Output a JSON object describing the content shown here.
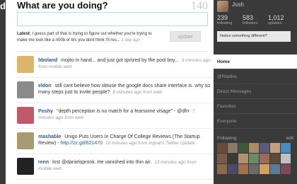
{
  "header": {
    "logo_fragment": "d",
    "question": "What are you doing?",
    "char_count": "140",
    "update_button": "update",
    "latest_label": "Latest:",
    "latest_text": "I guess part of that is trying to figure out whether you're trying to make me look like a n00b or b/c you dont think I'll res...",
    "latest_meta": "1 day ago"
  },
  "tweets": [
    {
      "user": "bboland",
      "text": "mojito in hand... and just got sprized by the pool boy...",
      "meta": "6 minutes ago from mobile web",
      "link": "",
      "avatar_color": "#d9b56e"
    },
    {
      "user": "eldon",
      "text": "still cant believe how obtuse the google docs share interface is. why so many steps just to invite people?",
      "meta": "6 minutes ago from web",
      "link": "",
      "avatar_color": "#8a8a8a"
    },
    {
      "user": "Poshy",
      "text": "\"depth perception is no match for a fearsome visage\" - @dfrr",
      "meta": "7 minutes ago from web",
      "link": "",
      "avatar_color": "#c05a6a"
    },
    {
      "user": "mashable",
      "text": "Unigo Puts Users In Charge Of College Reviews (The Startup Review) -",
      "meta": "10 minutes ago from Ingoal's Twitter Update",
      "link": "http://zz.gd/621470",
      "avatar_color": "#a89a72"
    },
    {
      "user": "renn",
      "text": "lost @danielspronk. He vanished into thin air.",
      "meta": "13 minutes ago from mobile web",
      "link": "",
      "avatar_color": "#222222"
    }
  ],
  "sidebar": {
    "name": "Josh",
    "stats": [
      {
        "num": "239",
        "label": "following"
      },
      {
        "num": "583",
        "label": "followers"
      },
      {
        "num": "1,012",
        "label": "updates"
      }
    ],
    "notice": "Notice something different?",
    "nav": [
      {
        "label": "Home",
        "active": true
      },
      {
        "label": "@Replies",
        "active": false
      },
      {
        "label": "Direct Messages",
        "active": false
      },
      {
        "label": "Favorites",
        "active": false
      },
      {
        "label": "Everyone",
        "active": false
      }
    ],
    "following_label": "Following",
    "following_action": "edit"
  },
  "colors": {
    "accent_link": "#2a5a8a",
    "sidebar_bg": "#3a3a3a",
    "box_border": "#b7d8e8"
  },
  "following_avatar_colors": [
    "#6a4a3a",
    "#8a7a6a",
    "#3a5a3a",
    "#aa8a6a",
    "#5a5a7a",
    "#c0a080",
    "#4a8ac0",
    "#7a5a4a",
    "#3a3a3a",
    "#b09070",
    "#6a8a6a",
    "#9a6a5a",
    "#5a4a3a",
    "#c0c0c0",
    "#8a6a4a",
    "#4a4a6a",
    "#a07050",
    "#6a6a6a",
    "#d0a060",
    "#5a7a9a",
    "#7a4a5a"
  ]
}
